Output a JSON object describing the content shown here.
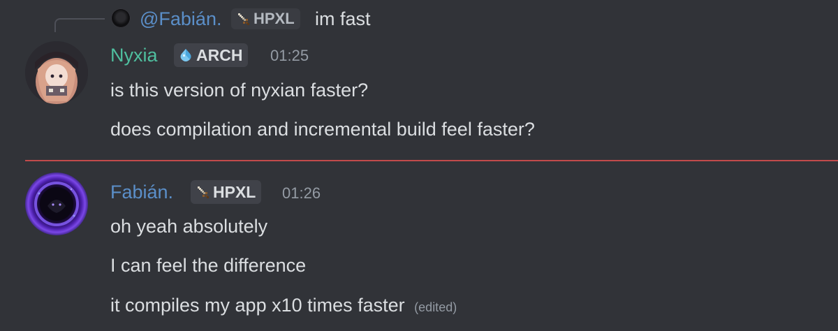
{
  "reply": {
    "name": "@Fabián.",
    "tag": "HPXL",
    "text": "im fast"
  },
  "messages": [
    {
      "author": "Nyxia",
      "tag": "ARCH",
      "time": "01:25",
      "lines": [
        "is this version of nyxian faster?",
        "does compilation and incremental build feel faster?"
      ]
    },
    {
      "author": "Fabián.",
      "tag": "HPXL",
      "time": "01:26",
      "lines": [
        "oh yeah absolutely",
        "I can feel the difference",
        "it compiles my app x10 times faster"
      ],
      "edited": "(edited)"
    }
  ],
  "colors": {
    "background": "#313338",
    "nyxia_name": "#4fbf9f",
    "fabian_name": "#5b8fc9",
    "new_messages_divider": "#c24b4b"
  },
  "icons": {
    "hpxl_tag": "sword-icon",
    "arch_tag": "water-drop-icon"
  }
}
